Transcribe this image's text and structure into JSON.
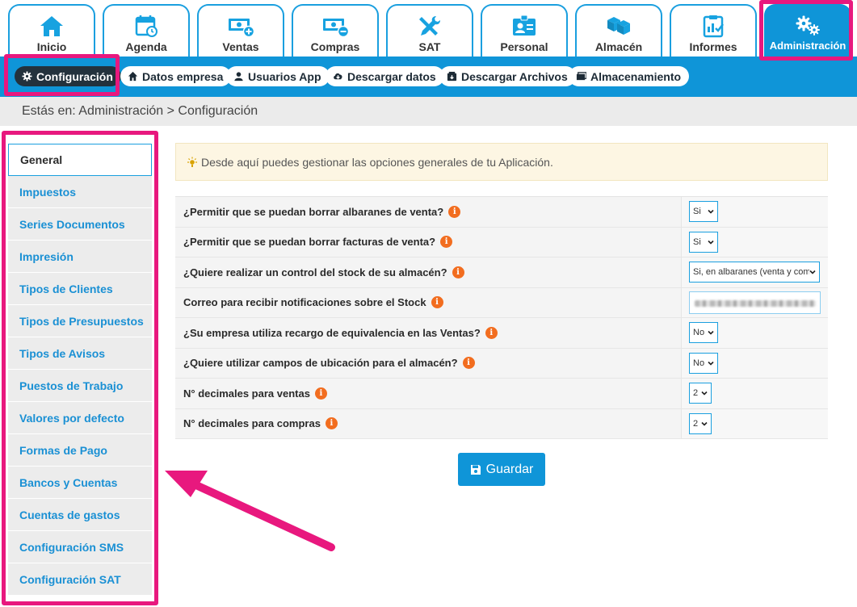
{
  "top_tabs": [
    {
      "label": "Inicio",
      "icon": "home-icon"
    },
    {
      "label": "Agenda",
      "icon": "calendar-icon"
    },
    {
      "label": "Ventas",
      "icon": "money-plus-icon"
    },
    {
      "label": "Compras",
      "icon": "money-minus-icon"
    },
    {
      "label": "SAT",
      "icon": "tools-icon"
    },
    {
      "label": "Personal",
      "icon": "id-card-icon"
    },
    {
      "label": "Almacén",
      "icon": "boxes-icon"
    },
    {
      "label": "Informes",
      "icon": "clipboard-chart-icon"
    },
    {
      "label": "Administración",
      "icon": "gears-icon",
      "active": true
    }
  ],
  "sub_tabs": [
    {
      "label": "Configuración",
      "icon": "gear-icon",
      "active": true
    },
    {
      "label": "Datos empresa",
      "icon": "home-icon"
    },
    {
      "label": "Usuarios App",
      "icon": "user-icon"
    },
    {
      "label": "Descargar datos",
      "icon": "cloud-download-icon"
    },
    {
      "label": "Descargar Archivos",
      "icon": "archive-download-icon"
    },
    {
      "label": "Almacenamiento",
      "icon": "folder-icon"
    }
  ],
  "breadcrumb": "Estás en: Administración > Configuración",
  "left_menu": [
    {
      "label": "General",
      "active": true
    },
    {
      "label": "Impuestos"
    },
    {
      "label": "Series Documentos"
    },
    {
      "label": "Impresión"
    },
    {
      "label": "Tipos de Clientes"
    },
    {
      "label": "Tipos de Presupuestos"
    },
    {
      "label": "Tipos de Avisos"
    },
    {
      "label": "Puestos de Trabajo"
    },
    {
      "label": "Valores por defecto"
    },
    {
      "label": "Formas de Pago"
    },
    {
      "label": "Bancos y Cuentas"
    },
    {
      "label": "Cuentas de gastos"
    },
    {
      "label": "Configuración SMS"
    },
    {
      "label": "Configuración SAT"
    }
  ],
  "info_text": "Desde aquí puedes gestionar las opciones generales de tu Aplicación.",
  "settings": [
    {
      "question": "¿Permitir que se puedan borrar albaranes de venta?",
      "value": "Si"
    },
    {
      "question": "¿Permitir que se puedan borrar facturas de venta?",
      "value": "Si"
    },
    {
      "question": "¿Quiere realizar un control del stock de su almacén?",
      "value": "Si, en albaranes (venta y com"
    },
    {
      "question": "Correo para recibir notificaciones sobre el Stock",
      "value": ""
    },
    {
      "question": "¿Su empresa utiliza recargo de equivalencia en las Ventas?",
      "value": "No"
    },
    {
      "question": "¿Quiere utilizar campos de ubicación para el almacén?",
      "value": "No"
    },
    {
      "question": "N° decimales para ventas",
      "value": "2"
    },
    {
      "question": "N° decimales para compras",
      "value": "2"
    }
  ],
  "info_marker": "i",
  "save_label": "Guardar",
  "colors": {
    "primary": "#0f95d8",
    "highlight": "#e8187e",
    "info_dot": "#f26d1f",
    "active_pill": "#23323d"
  }
}
